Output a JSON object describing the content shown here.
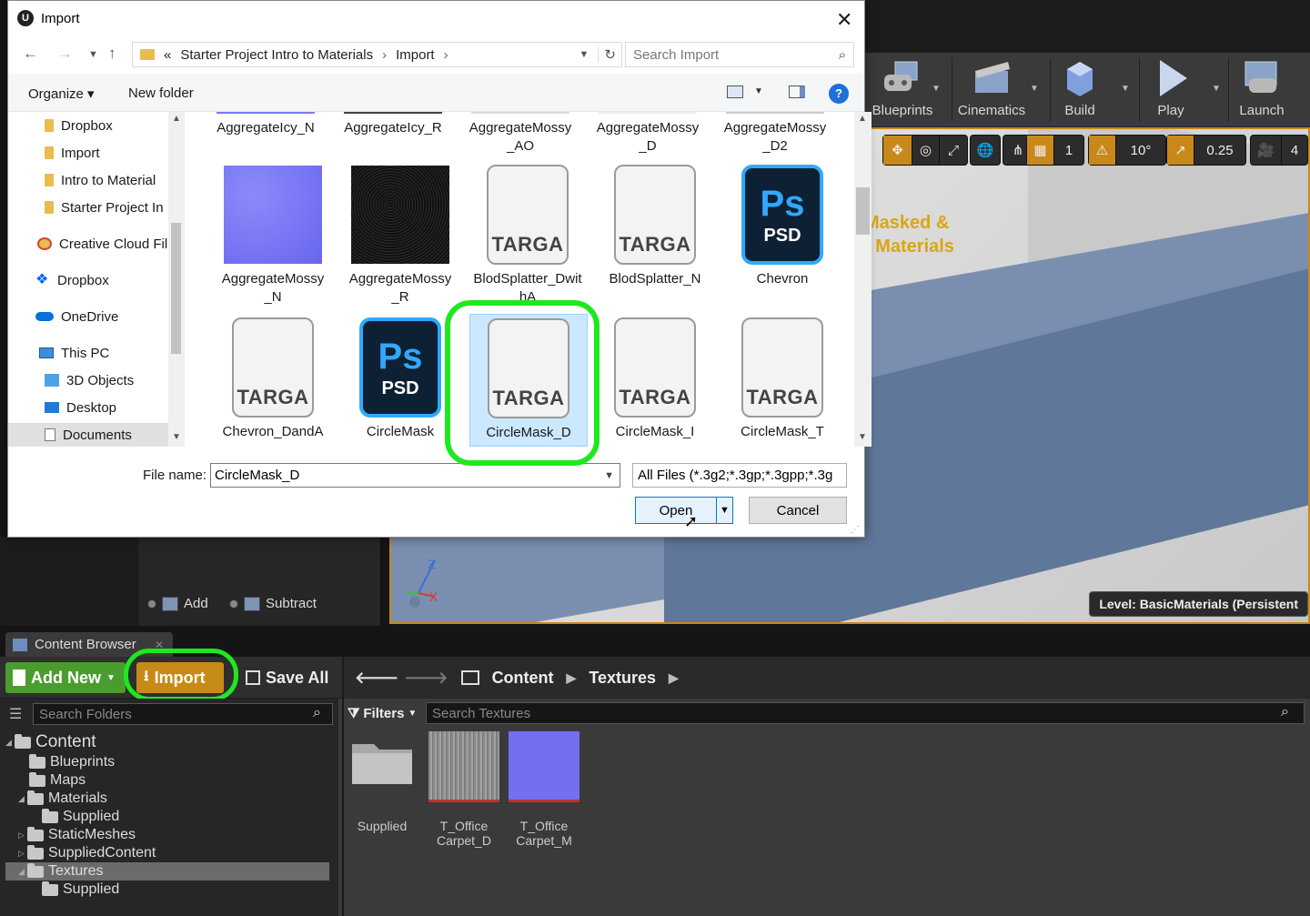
{
  "dialog": {
    "title": "Import",
    "breadcrumb": [
      "«",
      "Starter Project Intro to Materials",
      "Import"
    ],
    "search_placeholder": "Search Import",
    "organize_label": "Organize ▾",
    "new_folder_label": "New folder",
    "nav_items": [
      {
        "label": "Dropbox",
        "icon": "folder-icon"
      },
      {
        "label": "Import",
        "icon": "folder-icon"
      },
      {
        "label": "Intro to Material",
        "icon": "folder-icon"
      },
      {
        "label": "Starter Project In",
        "icon": "folder-icon"
      },
      {
        "label": "Creative Cloud File",
        "icon": "creative-cloud-icon"
      },
      {
        "label": "Dropbox",
        "icon": "dropbox-icon"
      },
      {
        "label": "OneDrive",
        "icon": "onedrive-icon"
      },
      {
        "label": "This PC",
        "icon": "computer-icon"
      },
      {
        "label": "3D Objects",
        "icon": "3d-objects-icon"
      },
      {
        "label": "Desktop",
        "icon": "desktop-icon"
      },
      {
        "label": "Documents",
        "icon": "documents-icon"
      }
    ],
    "top_row_files": [
      "AggregateIcy_N",
      "AggregateIcy_R",
      "AggregateMossy_AO",
      "AggregateMossy_D",
      "AggregateMossy_D2"
    ],
    "files_row2": [
      {
        "name": "AggregateMossy_N",
        "type": "normal"
      },
      {
        "name": "AggregateMossy_R",
        "type": "rough"
      },
      {
        "name": "BlodSplatter_DwithA",
        "type": "targa"
      },
      {
        "name": "BlodSplatter_N",
        "type": "targa"
      },
      {
        "name": "Chevron",
        "type": "psd"
      }
    ],
    "files_row3": [
      {
        "name": "Chevron_DandA",
        "type": "targa"
      },
      {
        "name": "CircleMask",
        "type": "psd"
      },
      {
        "name": "CircleMask_D",
        "type": "targa",
        "selected": true
      },
      {
        "name": "CircleMask_I",
        "type": "targa"
      },
      {
        "name": "CircleMask_T",
        "type": "targa"
      }
    ],
    "targa_label": "TARGA",
    "psd_label": "PSD",
    "ps_label": "Ps",
    "file_name_label": "File name:",
    "file_name_value": "CircleMask_D",
    "file_type_value": "All Files (*.3g2;*.3gp;*.3gpp;*.3g",
    "open_label": "Open",
    "cancel_label": "Cancel"
  },
  "toolbar": {
    "buttons": [
      {
        "label": "Blueprints",
        "icon": "blueprints-icon"
      },
      {
        "label": "Cinematics",
        "icon": "cinematics-icon"
      },
      {
        "label": "Build",
        "icon": "build-icon"
      },
      {
        "label": "Play",
        "icon": "play-icon"
      },
      {
        "label": "Launch",
        "icon": "launch-icon"
      }
    ]
  },
  "viewport": {
    "grid_value": "1",
    "angle_value": "10°",
    "scale_value": "0.25",
    "camera_speed": "4",
    "sign_line1": "Masked &",
    "sign_line2": "t Materials",
    "level_label": "Level:  BasicMaterials (Persistent",
    "axis_z": "Z",
    "axis_x": "X"
  },
  "brush": {
    "add_label": "Add",
    "subtract_label": "Subtract"
  },
  "content_browser": {
    "tab_label": "Content Browser",
    "add_new_label": "Add New",
    "import_label": "Import",
    "save_all_label": "Save All",
    "path": [
      "Content",
      "Textures"
    ],
    "folder_search_placeholder": "Search Folders",
    "filters_label": "Filters",
    "asset_search_placeholder": "Search Textures",
    "tree": [
      {
        "label": "Content",
        "depth": 0,
        "expanded": true
      },
      {
        "label": "Blueprints",
        "depth": 1
      },
      {
        "label": "Maps",
        "depth": 1
      },
      {
        "label": "Materials",
        "depth": 1,
        "expanded": true
      },
      {
        "label": "Supplied",
        "depth": 2
      },
      {
        "label": "StaticMeshes",
        "depth": 1,
        "collapsed": true
      },
      {
        "label": "SuppliedContent",
        "depth": 1,
        "collapsed": true
      },
      {
        "label": "Textures",
        "depth": 1,
        "expanded": true,
        "selected": true
      },
      {
        "label": "Supplied",
        "depth": 2
      }
    ],
    "assets": [
      {
        "name": "Supplied",
        "type": "folder"
      },
      {
        "name": "T_Office Carpet_D",
        "line1": "T_Office",
        "line2": "Carpet_D",
        "type": "texture-gray"
      },
      {
        "name": "T_Office Carpet_M",
        "line1": "T_Office",
        "line2": "Carpet_M",
        "type": "texture-normal"
      }
    ]
  },
  "colors": {
    "highlight_ring": "#1ee81e",
    "ue_orange": "#c8881a",
    "add_new_green": "#4a9c2f",
    "selection_blue": "#cce8ff"
  }
}
